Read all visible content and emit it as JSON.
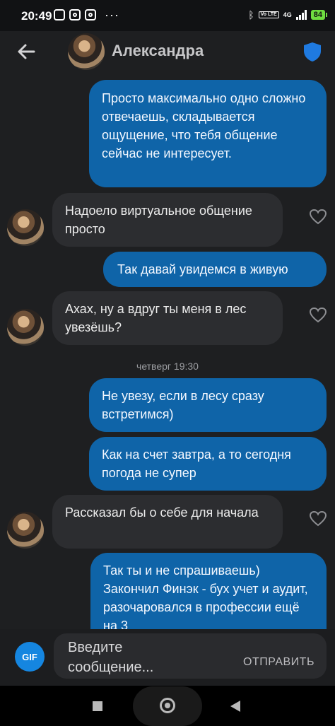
{
  "status_bar": {
    "time": "20:49",
    "network": "4G",
    "volte": "Vo LTE",
    "battery": "84"
  },
  "header": {
    "contact_name": "Александра",
    "back_icon": "arrow-left-icon",
    "verified_icon": "shield-icon"
  },
  "messages": [
    {
      "direction": "out",
      "text": "Просто максимально одно сложно отвечаешь, складывается ощущение, что тебя общение сейчас не интересует."
    },
    {
      "direction": "in",
      "text": "Надоело виртуальное общение просто"
    },
    {
      "direction": "out",
      "text": "Так давай увидемся в живую"
    },
    {
      "direction": "in",
      "text": "Ахах, ну а вдруг ты меня в лес увезёшь?"
    },
    {
      "direction": "out",
      "text": "Не увезу, если в лесу сразу встретимся)"
    },
    {
      "direction": "out",
      "text": "Как на счет завтра, а то сегодня погода не супер"
    },
    {
      "direction": "in",
      "text": "Рассказал бы о себе для начала"
    },
    {
      "direction": "out",
      "text": "Так ты и не спрашиваешь) Закончил Финэк - бух учет и аудит, разочаровался в профессии ещё на 3"
    }
  ],
  "date_separator": "четверг 19:30",
  "composer": {
    "gif_label": "GIF",
    "placeholder": "Введите сообщение...",
    "send_label": "ОТПРАВИТЬ"
  },
  "colors": {
    "outgoing_bubble": "#0f64a8",
    "incoming_bubble": "#2c2d30",
    "background": "#1e1f21",
    "gif_button": "#1586e0",
    "battery": "#6fdc40"
  }
}
